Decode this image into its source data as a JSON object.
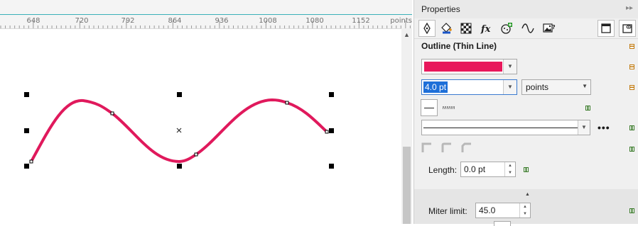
{
  "ruler": {
    "labels": [
      "648",
      "720",
      "792",
      "864",
      "936",
      "1008",
      "1080",
      "1152"
    ],
    "unit": "points"
  },
  "panel": {
    "title": "Properties",
    "tabs": [
      "outline-pen",
      "fill",
      "transparency",
      "effects",
      "summary",
      "curve",
      "bitmap"
    ],
    "section_title": "Outline (Thin Line)",
    "outline_color": "#e8185c",
    "width_value": "4.0 pt",
    "units": "points",
    "length_label": "Length:",
    "length_value": "0.0 pt",
    "miter_label": "Miter limit:",
    "miter_value": "45.0"
  },
  "colors": {
    "curve": "#e0195c",
    "accent_teal": "#3ab0b8",
    "selection_blue": "#1e6fd8"
  }
}
